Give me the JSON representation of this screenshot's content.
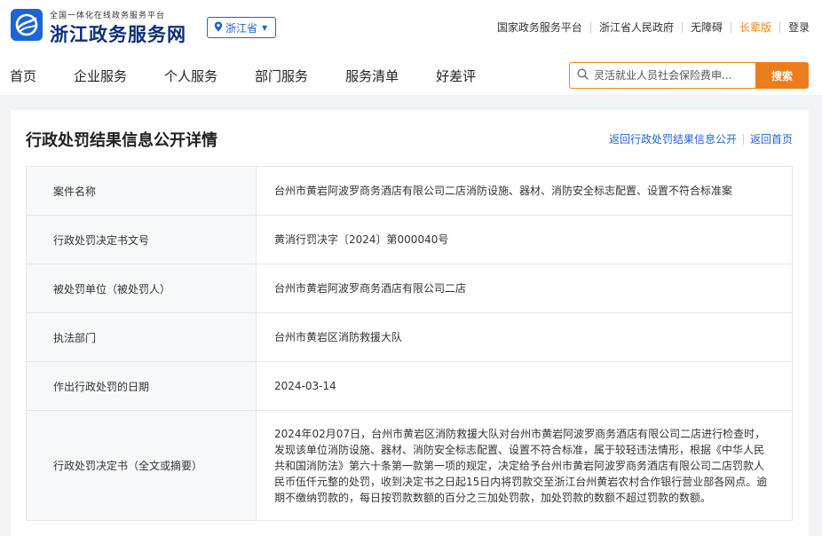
{
  "header": {
    "logo_subtitle": "全国一体化在线政务服务平台",
    "logo_title": "浙江政务服务网",
    "logo_icon": "zhejiang-gov-logo-icon",
    "region": "浙江省",
    "region_icon": "location-pin-icon",
    "links": [
      "国家政务服务平台",
      "浙江省人民政府",
      "无障碍",
      "长辈版",
      "登录"
    ]
  },
  "nav": {
    "items": [
      "首页",
      "企业服务",
      "个人服务",
      "部门服务",
      "服务清单",
      "好差评"
    ],
    "search_placeholder": "灵活就业人员社会保险费申...",
    "search_icon": "search-icon",
    "search_button": "搜索"
  },
  "page": {
    "title": "行政处罚结果信息公开详情",
    "back_list": "返回行政处罚结果信息公开",
    "back_home": "返回首页"
  },
  "details": [
    {
      "label": "案件名称",
      "value": "台州市黄岩阿波罗商务酒店有限公司二店消防设施、器材、消防安全标志配置、设置不符合标准案"
    },
    {
      "label": "行政处罚决定书文号",
      "value": "黄消行罚决字〔2024〕第000040号"
    },
    {
      "label": "被处罚单位（被处罚人）",
      "value": "台州市黄岩阿波罗商务酒店有限公司二店"
    },
    {
      "label": "执法部门",
      "value": "台州市黄岩区消防救援大队"
    },
    {
      "label": "作出行政处罚的日期",
      "value": "2024-03-14"
    },
    {
      "label": "行政处罚决定书（全文或摘要）",
      "value": "2024年02月07日，台州市黄岩区消防救援大队对台州市黄岩阿波罗商务酒店有限公司二店进行检查时，发现该单位消防设施、器材、消防安全标志配置、设置不符合标准，属于较轻违法情形，根据《中华人民共和国消防法》第六十条第一款第一项的规定，决定给予台州市黄岩阿波罗商务酒店有限公司二店罚款人民币伍仟元整的处罚，收到决定书之日起15日内将罚款交至浙江台州黄岩农村合作银行营业部各网点。逾期不缴纳罚款的，每日按罚款数额的百分之三加处罚款，加处罚款的数额不超过罚款的数额。"
    }
  ]
}
